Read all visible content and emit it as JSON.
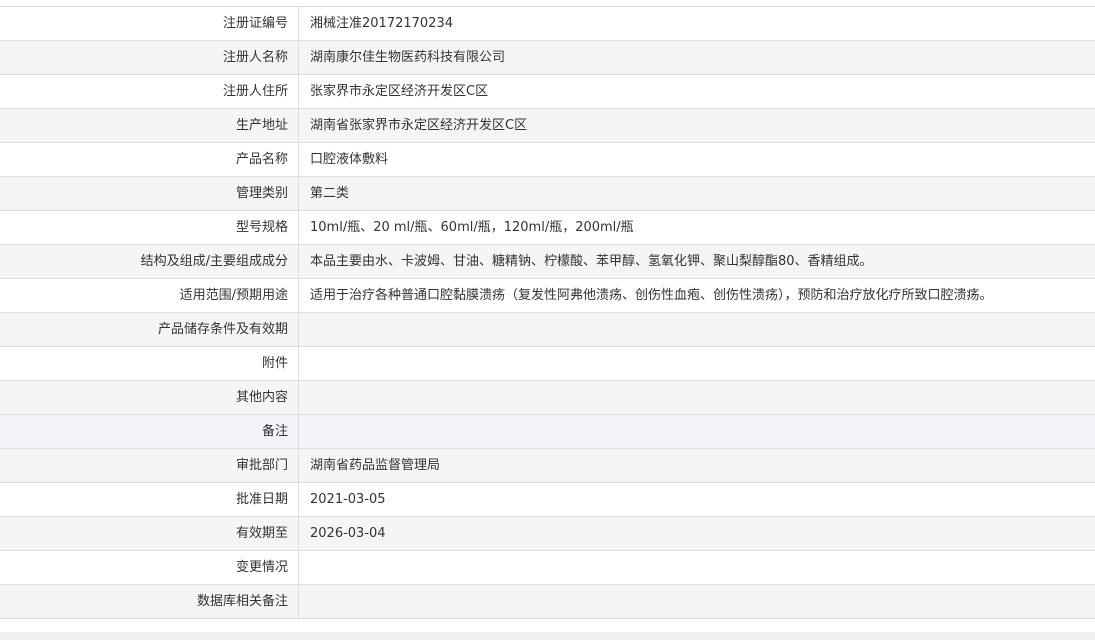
{
  "rows": [
    {
      "label": "注册证编号",
      "value": "湘械注准20172170234"
    },
    {
      "label": "注册人名称",
      "value": "湖南康尔佳生物医药科技有限公司"
    },
    {
      "label": "注册人住所",
      "value": "张家界市永定区经济开发区C区"
    },
    {
      "label": "生产地址",
      "value": "湖南省张家界市永定区经济开发区C区"
    },
    {
      "label": "产品名称",
      "value": "口腔液体敷料"
    },
    {
      "label": "管理类别",
      "value": "第二类"
    },
    {
      "label": "型号规格",
      "value": "10ml/瓶、20 ml/瓶、60ml/瓶，120ml/瓶，200ml/瓶"
    },
    {
      "label": "结构及组成/主要组成成分",
      "value": "本品主要由水、卡波姆、甘油、糖精钠、柠檬酸、苯甲醇、氢氧化钾、聚山梨醇酯80、香精组成。"
    },
    {
      "label": "适用范围/预期用途",
      "value": "适用于治疗各种普通口腔黏膜溃疡（复发性阿弗他溃疡、创伤性血疱、创伤性溃疡），预防和治疗放化疗所致口腔溃疡。"
    },
    {
      "label": "产品储存条件及有效期",
      "value": ""
    },
    {
      "label": "附件",
      "value": ""
    },
    {
      "label": "其他内容",
      "value": ""
    },
    {
      "label": "备注",
      "value": ""
    },
    {
      "label": "审批部门",
      "value": "湖南省药品监督管理局"
    },
    {
      "label": "批准日期",
      "value": "2021-03-05"
    },
    {
      "label": "有效期至",
      "value": "2026-03-04"
    },
    {
      "label": "变更情况",
      "value": ""
    },
    {
      "label": "数据库相关备注",
      "value": ""
    }
  ]
}
